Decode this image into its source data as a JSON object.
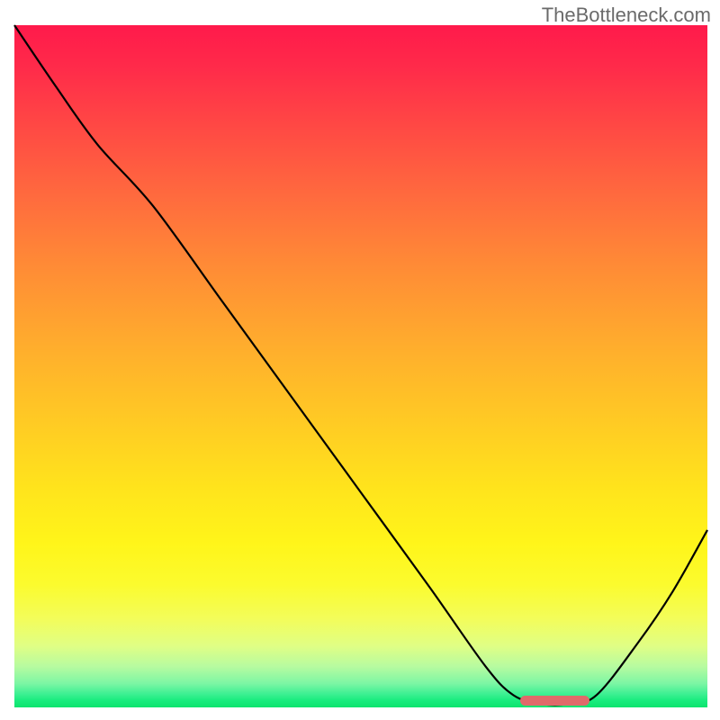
{
  "watermark": "TheBottleneck.com",
  "colors": {
    "top": "#ff1a4b",
    "mid": "#ffe41c",
    "bottom": "#0de36e",
    "curve": "#000000",
    "optimal_bar": "#e06a6a"
  },
  "chart_data": {
    "type": "line",
    "title": "",
    "xlabel": "",
    "ylabel": "",
    "xlim": [
      0,
      100
    ],
    "ylim": [
      0,
      100
    ],
    "series": [
      {
        "name": "bottleneck-curve",
        "x": [
          0,
          6,
          12,
          20,
          30,
          40,
          50,
          60,
          68,
          72,
          76,
          80,
          84,
          90,
          95,
          100
        ],
        "values": [
          100,
          91,
          82.5,
          73.5,
          59.5,
          45.5,
          31.5,
          17.5,
          6,
          1.8,
          0.5,
          0.5,
          1.8,
          9.5,
          17,
          26
        ]
      }
    ],
    "optimal_range_x": [
      73,
      83
    ],
    "annotations": []
  }
}
